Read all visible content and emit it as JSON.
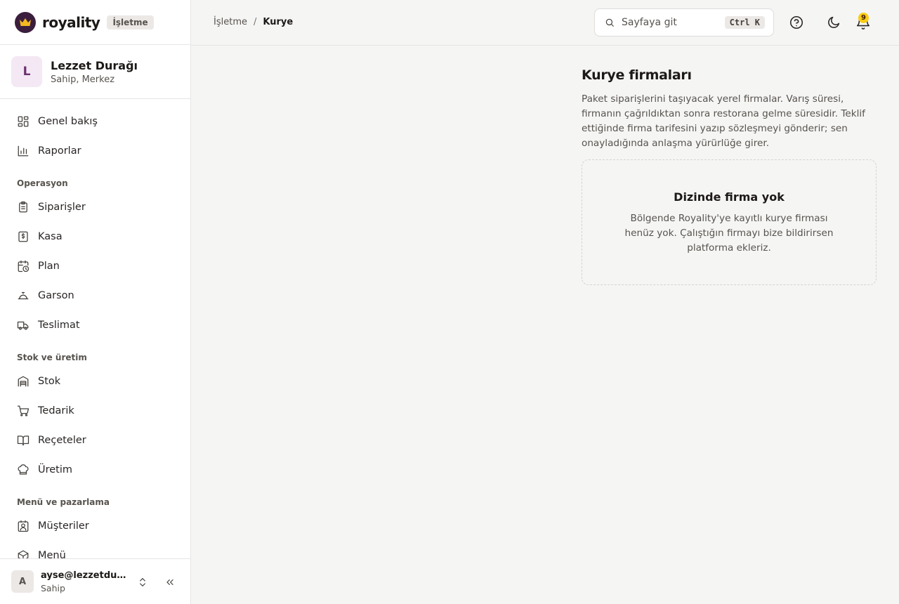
{
  "brand": {
    "name": "royality",
    "badge": "İşletme"
  },
  "org": {
    "initial": "L",
    "name": "Lezzet Durağı",
    "subtitle": "Sahip, Merkez"
  },
  "nav": {
    "top": [
      {
        "label": "Genel bakış",
        "icon": "layout-grid-icon"
      },
      {
        "label": "Raporlar",
        "icon": "bar-chart-icon"
      }
    ],
    "groups": [
      {
        "title": "Operasyon",
        "items": [
          {
            "label": "Siparişler",
            "icon": "clipboard-list-icon"
          },
          {
            "label": "Kasa",
            "icon": "cash-register-icon"
          },
          {
            "label": "Plan",
            "icon": "calendar-clock-icon"
          },
          {
            "label": "Garson",
            "icon": "waiter-cloche-icon"
          },
          {
            "label": "Teslimat",
            "icon": "truck-icon"
          }
        ]
      },
      {
        "title": "Stok ve üretim",
        "items": [
          {
            "label": "Stok",
            "icon": "warehouse-icon"
          },
          {
            "label": "Tedarik",
            "icon": "shopping-cart-icon"
          },
          {
            "label": "Reçeteler",
            "icon": "book-open-icon"
          },
          {
            "label": "Üretim",
            "icon": "chef-hat-icon"
          }
        ]
      },
      {
        "title": "Menü ve pazarlama",
        "items": [
          {
            "label": "Müşteriler",
            "icon": "contact-icon"
          },
          {
            "label": "Menü",
            "icon": "package-icon"
          }
        ]
      }
    ]
  },
  "user": {
    "initial": "A",
    "email": "ayse@lezzetduragi.com",
    "role": "Sahip"
  },
  "header": {
    "breadcrumb": [
      "İşletme",
      "Kurye"
    ],
    "breadcrumb_separator": "/",
    "search": {
      "placeholder": "Sayfaya git",
      "shortcut": "Ctrl K"
    },
    "notifications_count": "9"
  },
  "main": {
    "title": "Kurye firmaları",
    "description": "Paket siparişlerini taşıyacak yerel firmalar. Varış süresi, firmanın çağrıldıktan sonra restorana gelme süresidir. Teklif ettiğinde firma tarifesini yazıp sözleşmeyi gönderir; sen onayladığında anlaşma yürürlüğe girer.",
    "empty": {
      "title": "Dizinde firma yok",
      "description": "Bölgende Royality'ye kayıtlı kurye firması henüz yok. Çalıştığın firmayı bize bildirirsen platforma ekleriz."
    }
  },
  "colors": {
    "accent": "#3b1d3d",
    "badge": "#facc15",
    "background": "#f5f5f4"
  }
}
